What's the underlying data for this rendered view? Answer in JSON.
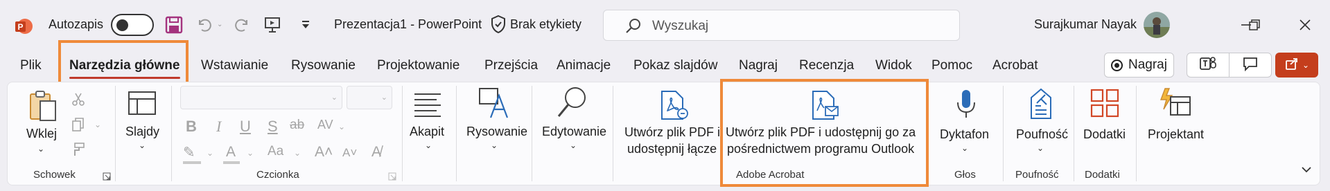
{
  "titlebar": {
    "autosave_label": "Autozapis",
    "document_title": "Prezentacja1  -  PowerPoint",
    "sensitivity_label": "Brak etykiety",
    "search_placeholder": "Wyszukaj",
    "user_name": "Surajkumar Nayak"
  },
  "tabs": [
    {
      "label": "Plik"
    },
    {
      "label": "Narzędzia główne"
    },
    {
      "label": "Wstawianie"
    },
    {
      "label": "Rysowanie"
    },
    {
      "label": "Projektowanie"
    },
    {
      "label": "Przejścia"
    },
    {
      "label": "Animacje"
    },
    {
      "label": "Pokaz slajdów"
    },
    {
      "label": "Nagraj"
    },
    {
      "label": "Recenzja"
    },
    {
      "label": "Widok"
    },
    {
      "label": "Pomoc"
    },
    {
      "label": "Acrobat"
    }
  ],
  "right_actions": {
    "record_label": "Nagraj"
  },
  "ribbon": {
    "clipboard": {
      "paste_label": "Wklej",
      "group_label": "Schowek"
    },
    "slides": {
      "label": "Slajdy"
    },
    "font": {
      "group_label": "Czcionka"
    },
    "paragraph": {
      "label": "Akapit"
    },
    "drawing": {
      "label": "Rysowanie"
    },
    "editing": {
      "label": "Edytowanie"
    },
    "acrobat": {
      "create_share_label_1": "Utwórz plik PDF i",
      "create_share_label_2": "udostępnij łącze",
      "outlook_label_1": "Utwórz plik PDF i udostępnij go za",
      "outlook_label_2": "pośrednictwem programu Outlook",
      "group_label": "Adobe Acrobat"
    },
    "voice": {
      "dictate_label": "Dyktafon",
      "group_label": "Głos"
    },
    "sensitivity": {
      "label": "Poufność",
      "group_label": "Poufność"
    },
    "addins": {
      "label": "Dodatki",
      "group_label": "Dodatki"
    },
    "designer": {
      "label": "Projektant"
    }
  },
  "colors": {
    "accent_red": "#c43e1c",
    "highlight_orange": "#ef8a3a",
    "save_purple": "#a4337e",
    "acrobat_blue": "#2b6cb8"
  }
}
